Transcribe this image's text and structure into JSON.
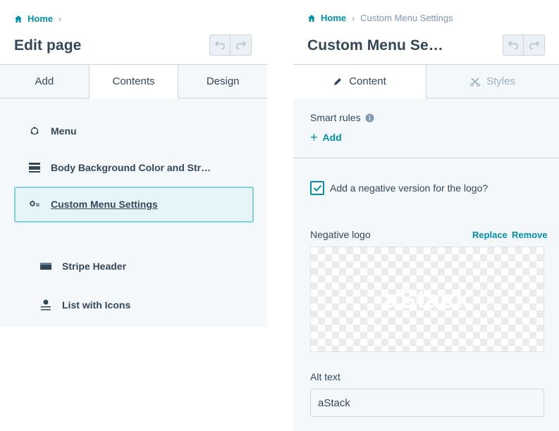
{
  "left": {
    "breadcrumb": {
      "home": "Home"
    },
    "title": "Edit page",
    "tabs": [
      {
        "label": "Add"
      },
      {
        "label": "Contents"
      },
      {
        "label": "Design"
      }
    ],
    "items": [
      {
        "label": "Menu",
        "icon": "menu-icon"
      },
      {
        "label": "Body Background Color and Str…",
        "icon": "stripe-icon"
      },
      {
        "label": "Custom Menu Settings",
        "icon": "settings-icon",
        "selected": true
      },
      {
        "label": "Stripe Header",
        "icon": "stripe-header-icon"
      },
      {
        "label": "List with Icons",
        "icon": "list-icon"
      }
    ]
  },
  "right": {
    "breadcrumb": {
      "home": "Home",
      "current": "Custom Menu Settings"
    },
    "title": "Custom Menu Se…",
    "tabs": [
      {
        "label": "Content",
        "icon": "pencil-icon"
      },
      {
        "label": "Styles",
        "icon": "scissors-icon"
      }
    ],
    "smart_rules": {
      "label": "Smart rules",
      "add": "Add"
    },
    "negative_checkbox": {
      "label": "Add a negative version for the logo?",
      "checked": true
    },
    "negative_logo": {
      "label": "Negative logo",
      "replace": "Replace",
      "remove": "Remove",
      "logo_text": "aStack"
    },
    "alt_text": {
      "label": "Alt text",
      "value": "aStack"
    }
  },
  "colors": {
    "accent": "#0091ae",
    "text": "#33475b",
    "muted": "#7c98b6",
    "selected_bg": "#e5f5f8",
    "selected_border": "#7fd1de"
  }
}
